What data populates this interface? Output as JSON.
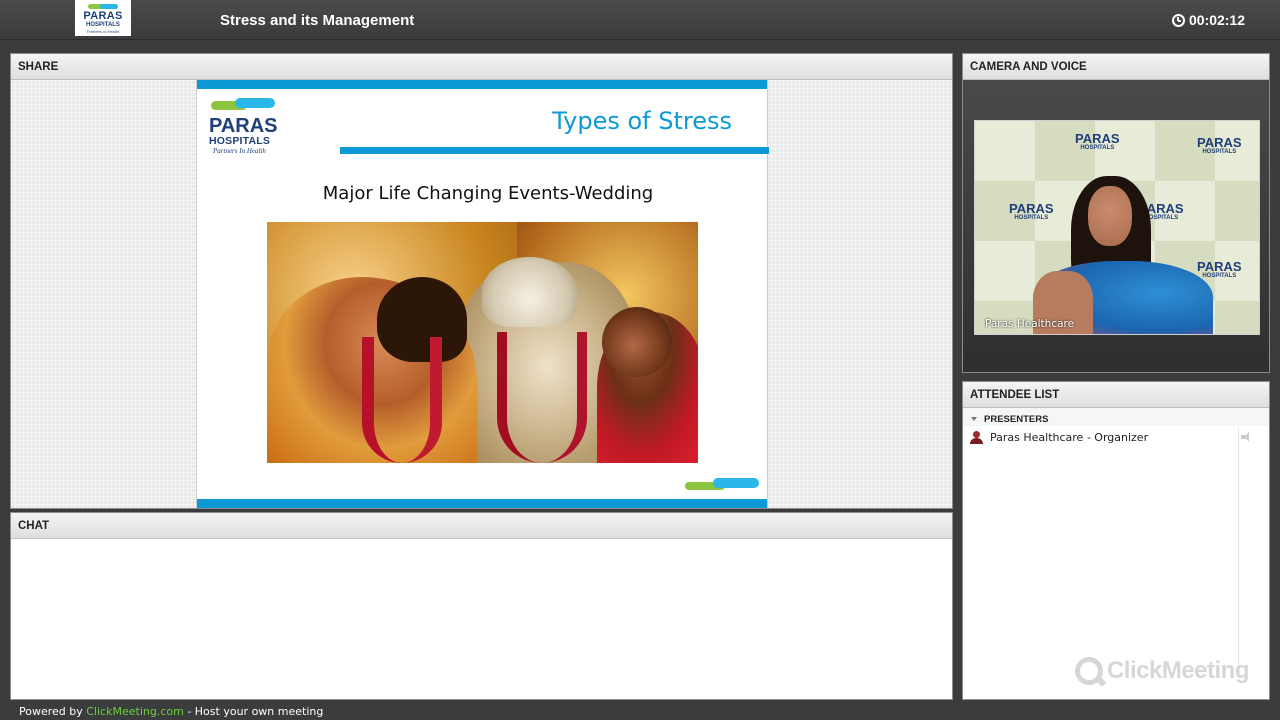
{
  "header": {
    "logo": {
      "name": "PARAS",
      "sub": "HOSPITALS",
      "tagline": "Partners In Health"
    },
    "meeting_title": "Stress and its Management",
    "timer": "00:02:12"
  },
  "share": {
    "panel_title": "SHARE",
    "slide": {
      "title": "Types of Stress",
      "subtitle": "Major Life Changing Events-Wedding",
      "logo": {
        "name": "PARAS",
        "sub": "HOSPITALS",
        "tagline": "Partners In Health"
      }
    }
  },
  "chat": {
    "panel_title": "CHAT"
  },
  "camera": {
    "panel_title": "CAMERA AND VOICE",
    "participant_name": "Paras Healthcare",
    "backdrop_logo": {
      "name": "PARAS",
      "sub": "HOSPITALS"
    }
  },
  "attendees": {
    "panel_title": "ATTENDEE LIST",
    "group_label": "PRESENTERS",
    "items": [
      {
        "name": "Paras Healthcare - Organizer"
      }
    ],
    "brand": "ClickMeeting"
  },
  "footer": {
    "prefix": "Powered by ",
    "link": "ClickMeeting.com",
    "suffix": " - Host your own meeting"
  },
  "colors": {
    "accent_blue": "#0c9ad6",
    "logo_navy": "#1f3f78",
    "logo_green": "#8cc63f",
    "logo_cyan": "#29b6e8",
    "footer_link": "#6ccf3b",
    "topbar": "#3b3c3e"
  },
  "icons": [
    "clock-icon",
    "user-icon",
    "speaker-icon",
    "clickmeeting-logo-icon",
    "collapse-triangle-icon"
  ]
}
